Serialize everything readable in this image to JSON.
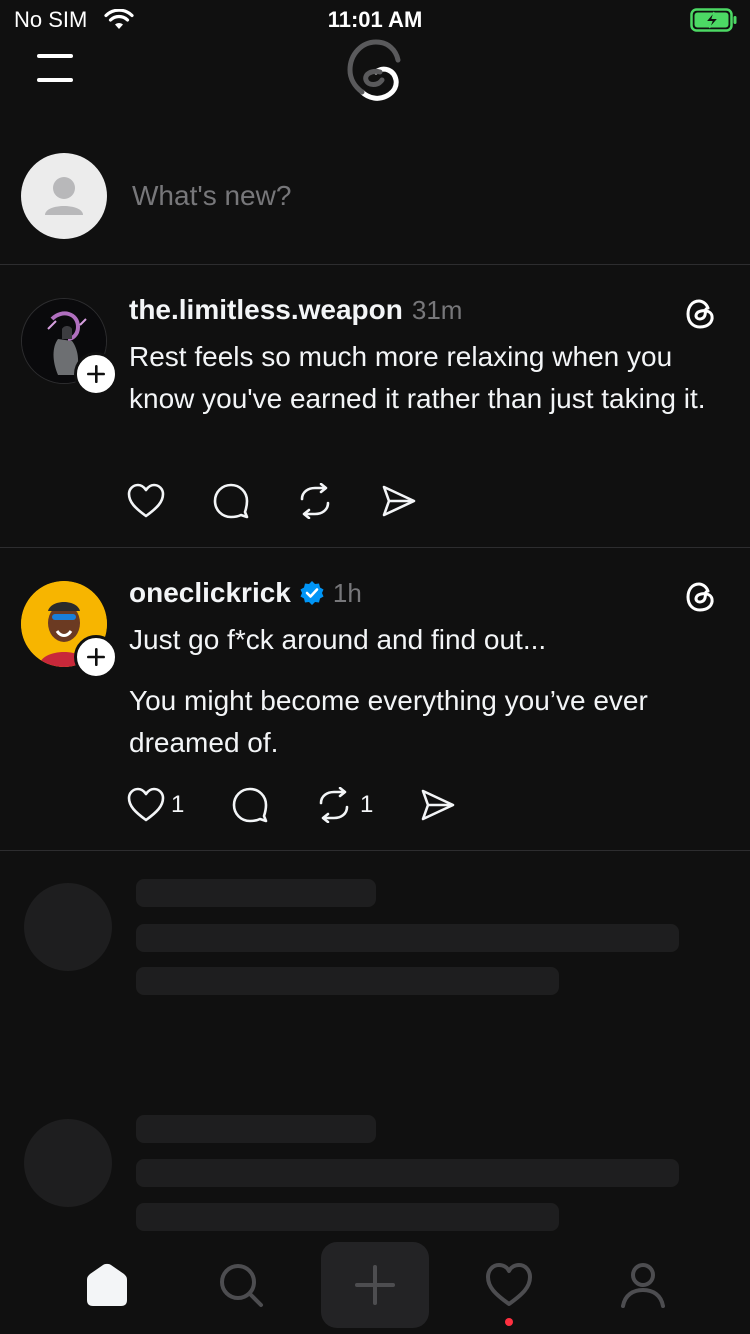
{
  "status_bar": {
    "carrier": "No SIM",
    "time": "11:01 AM"
  },
  "composer": {
    "placeholder": "What's new?"
  },
  "posts": [
    {
      "username": "the.limitless.weapon",
      "timestamp": "31m",
      "verified": false,
      "paragraphs": [
        "Rest feels so much more relaxing when you know you've earned it rather than just taking it."
      ],
      "like_count": "",
      "repost_count": ""
    },
    {
      "username": "oneclickrick",
      "timestamp": "1h",
      "verified": true,
      "paragraphs": [
        "Just go f*ck around and find out...",
        "You might become everything you’ve ever dreamed of."
      ],
      "like_count": "1",
      "repost_count": "1"
    }
  ],
  "icons": {
    "verified_badge_color": "#0095f6",
    "notification_dot_color": "#ff3040"
  }
}
